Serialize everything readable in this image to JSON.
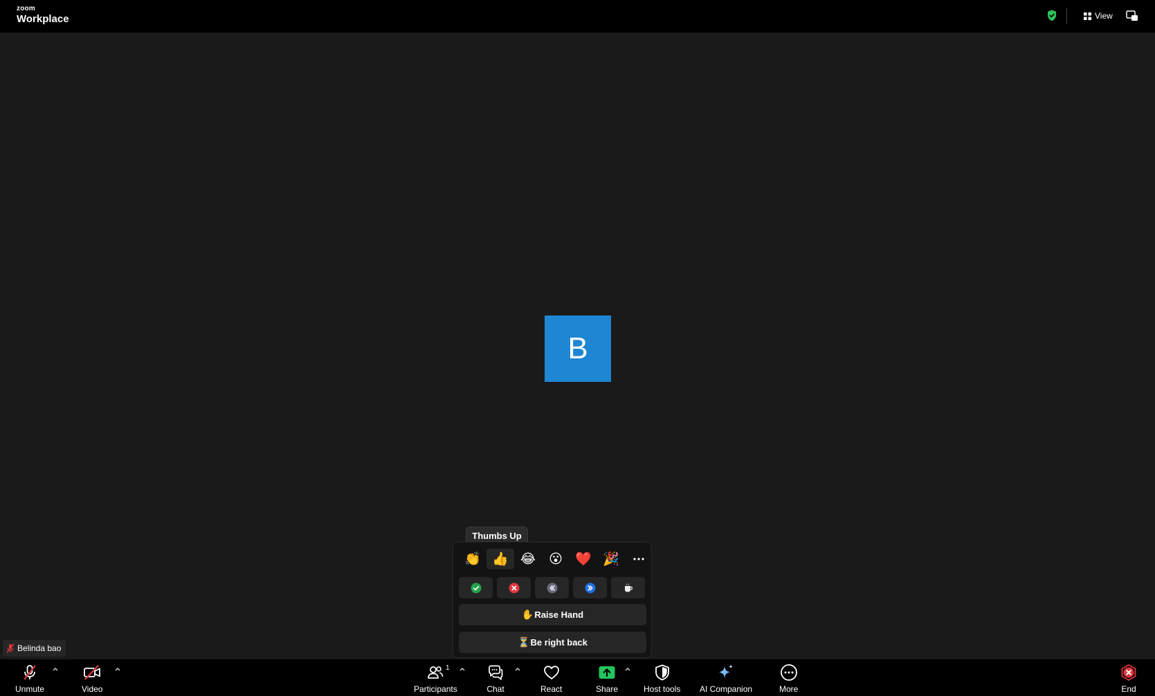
{
  "app": {
    "brand_small": "zoom",
    "brand_name": "Workplace"
  },
  "topbar": {
    "view_label": "View"
  },
  "participant": {
    "initial": "B",
    "name": "Belinda bao",
    "avatar_color": "#1f86d3"
  },
  "reactions": {
    "tooltip": "Thumbs Up",
    "emojis": [
      {
        "name": "clapping-hands",
        "glyph": "👏"
      },
      {
        "name": "thumbs-up",
        "glyph": "👍"
      },
      {
        "name": "tears-of-joy",
        "glyph": "😂"
      },
      {
        "name": "open-mouth",
        "glyph": "😮"
      },
      {
        "name": "heart",
        "glyph": "❤️"
      },
      {
        "name": "party-popper",
        "glyph": "🎉"
      }
    ],
    "more_icon": "ellipsis-icon",
    "status_buttons": [
      "yes-icon",
      "no-icon",
      "slow-down-icon",
      "speed-up-icon",
      "coffee-icon"
    ],
    "raise_hand_glyph": "✋",
    "raise_hand_label": "Raise Hand",
    "brb_glyph": "⏳",
    "brb_label": "Be right back"
  },
  "toolbar": {
    "unmute_label": "Unmute",
    "video_label": "Video",
    "participants_label": "Participants",
    "participants_count": "1",
    "chat_label": "Chat",
    "react_label": "React",
    "share_label": "Share",
    "host_tools_label": "Host tools",
    "ai_companion_label": "AI Companion",
    "more_label": "More",
    "end_label": "End"
  },
  "colors": {
    "share_green": "#22c55e",
    "end_red": "#e0373e",
    "muted_red": "#e0373e",
    "security_green": "#2fbf5a"
  }
}
